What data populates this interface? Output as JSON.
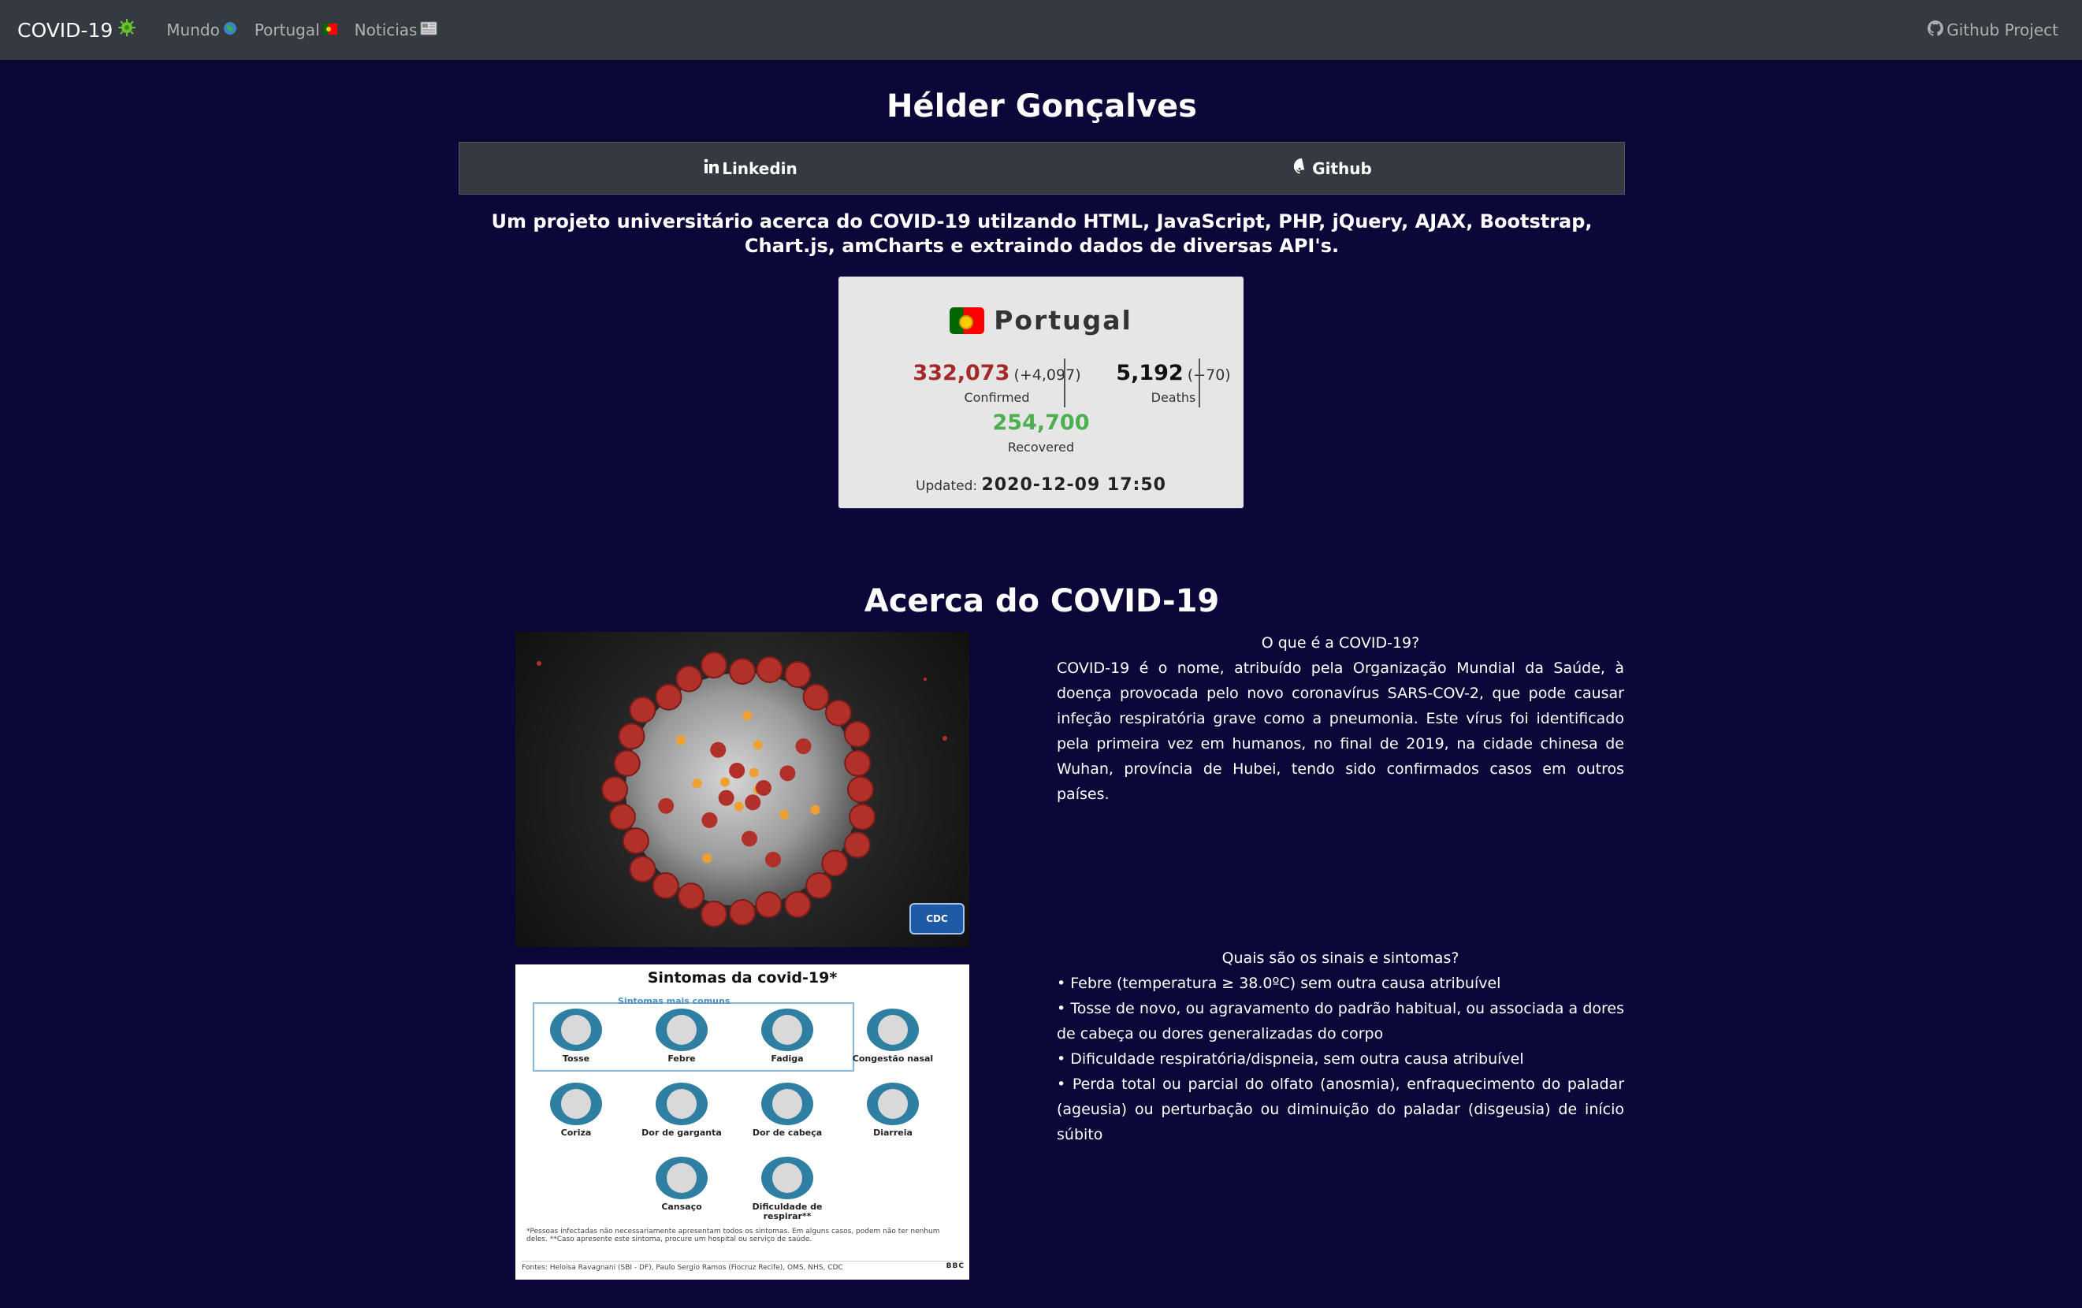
{
  "nav": {
    "brand": "COVID-19",
    "brand_icon": "virus-icon",
    "links": [
      {
        "label": "Mundo",
        "icon": "globe-icon"
      },
      {
        "label": "Portugal",
        "icon": "portugal-flag-icon"
      },
      {
        "label": "Noticias",
        "icon": "newspaper-icon"
      }
    ],
    "github": "Github Project"
  },
  "header": {
    "author": "Hélder Gonçalves",
    "linkedin": "Linkedin",
    "github": "Github",
    "intro": "Um projeto universitário acerca do COVID-19 utilzando HTML, JavaScript, PHP, jQuery, AJAX, Bootstrap, Chart.js, amCharts e extraindo dados de diversas API's."
  },
  "stats": {
    "country": "Portugal",
    "confirmed": "332,073",
    "confirmed_delta": "(+4,097)",
    "confirmed_label": "Confirmed",
    "deaths": "5,192",
    "deaths_delta": "(+70)",
    "deaths_label": "Deaths",
    "recovered": "254,700",
    "recovered_label": "Recovered",
    "updated_label": "Updated:",
    "updated_value": "2020-12-09 17:50",
    "colors": {
      "confirmed": "#a52a2a",
      "recovered": "#4caf50"
    }
  },
  "about": {
    "title": "Acerca do COVID-19",
    "q1": "O que é a COVID-19?",
    "a1": "COVID-19 é o nome, atribuído pela Organização Mundial da Saúde, à doença provocada pelo novo coronavírus SARS-COV-2, que pode causar infeção respiratória grave como a pneumonia. Este vírus foi identificado pela primeira vez em humanos, no final de 2019, na cidade chinesa de Wuhan, província de Hubei, tendo sido confirmados casos em outros países.",
    "q2": "Quais são os sinais e sintomas?",
    "symptoms": [
      "• Febre (temperatura ≥ 38.0ºC) sem outra causa atribuível",
      "• Tosse de novo, ou agravamento do padrão habitual, ou associada a dores de cabeça ou dores generalizadas do corpo",
      "• Dificuldade respiratória/dispneia, sem outra causa atribuível",
      "• Perda total ou parcial do olfato (anosmia), enfraquecimento do paladar (ageusia) ou perturbação ou diminuição do paladar (disgeusia) de início súbito"
    ]
  },
  "infographic": {
    "title": "Sintomas da covid-19*",
    "subtitle": "Sintomas mais comuns",
    "cdc": "CDC",
    "items": [
      "Tosse",
      "Febre",
      "Fadiga",
      "Congestão nasal",
      "Coriza",
      "Dor de garganta",
      "Dor de cabeça",
      "Diarreia",
      "Cansaço",
      "Dificuldade de respirar**"
    ],
    "note": "*Pessoas infectadas não necessariamente apresentam todos os sintomas. Em alguns casos, podem não ter nenhum deles. **Caso apresente este sintoma, procure um hospital ou serviço de saúde.",
    "source": "Fontes: Heloisa Ravagnani (SBI - DF), Paulo Sergio Ramos (Fiocruz Recife), OMS, NHS, CDC",
    "bbc": "BBC"
  }
}
